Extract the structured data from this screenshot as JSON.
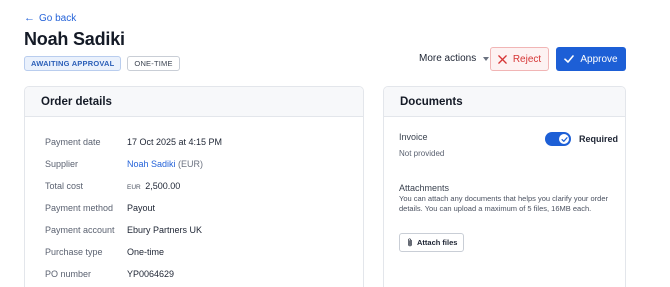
{
  "nav": {
    "back_label": "Go back"
  },
  "header": {
    "title": "Noah Sadiki",
    "badges": [
      "AWAITING APPROVAL",
      "ONE-TIME"
    ],
    "more_actions": "More actions",
    "reject": "Reject",
    "approve": "Approve"
  },
  "order": {
    "title": "Order details",
    "rows": [
      {
        "label": "Payment date",
        "value": "17 Oct 2025 at 4:15 PM"
      },
      {
        "label": "Supplier",
        "value": "Noah Sadiki",
        "suffix": "(EUR)"
      },
      {
        "label": "Total cost",
        "currency": "EUR",
        "value": "2,500.00"
      },
      {
        "label": "Payment method",
        "value": "Payout"
      },
      {
        "label": "Payment account",
        "value": "Ebury Partners UK"
      },
      {
        "label": "Purchase type",
        "value": "One-time"
      },
      {
        "label": "PO number",
        "value": "YP0064629"
      }
    ]
  },
  "documents": {
    "title": "Documents",
    "invoice_label": "Invoice",
    "invoice_status": "Not provided",
    "required_label": "Required",
    "required_on": true,
    "attachments_label": "Attachments",
    "attachments_desc": "You can attach any documents that helps you clarify your order details. You can upload a maximum of 5 files, 16MB each.",
    "attach_button": "Attach files"
  },
  "colors": {
    "primary": "#1d5fd6",
    "danger": "#d63636",
    "link": "#2563d9"
  }
}
